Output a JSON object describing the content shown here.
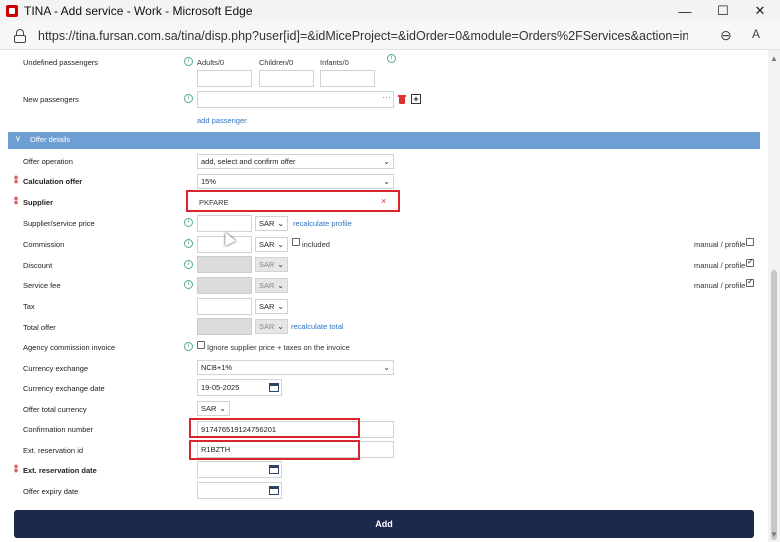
{
  "window": {
    "title": "TINA - Add service - Work - Microsoft Edge",
    "minimize": "—",
    "maximize": "☐",
    "close": "✕"
  },
  "address_bar": {
    "url": "https://tina.fursan.com.sa/tina/disp.php?user[id]=&idMiceProject=&idOrder=0&module=Orders%2FServices&action=insert"
  },
  "undefined_passengers": {
    "label": "Undefined passengers",
    "adults": "Adults/0",
    "children": "Children/0",
    "infants": "Infants/0"
  },
  "new_passengers": {
    "label": "New passengers",
    "add_link": "add passenger"
  },
  "section": {
    "title": "Offer details"
  },
  "fields": {
    "offer_operation": {
      "label": "Offer operation",
      "value": "add, select and confirm offer"
    },
    "calculation_offer": {
      "label": "Calculation offer",
      "value": "15%"
    },
    "supplier": {
      "label": "Supplier",
      "value": "PKFARE",
      "clear": "×"
    },
    "supplier_price": {
      "label": "Supplier/service price",
      "currency": "SAR",
      "link": "recalculate profile"
    },
    "commission": {
      "label": "Commission",
      "currency": "SAR",
      "included": "included",
      "right_label": "manual / profile"
    },
    "discount": {
      "label": "Discount",
      "currency": "SAR",
      "right_label": "manual / profile"
    },
    "service_fee": {
      "label": "Service fee",
      "currency": "SAR",
      "right_label": "manual / profile"
    },
    "tax": {
      "label": "Tax",
      "currency": "SAR"
    },
    "total_offer": {
      "label": "Total offer",
      "currency": "SAR",
      "link": "recalculate total"
    },
    "agency_commission": {
      "label": "Agency commission invoice",
      "checkbox_label": "Ignore supplier price + taxes on the invoice"
    },
    "currency_exchange": {
      "label": "Currency exchange",
      "value": "NCB+1%"
    },
    "currency_exchange_date": {
      "label": "Currency exchange date",
      "value": "19-05-2025"
    },
    "offer_total_currency": {
      "label": "Offer total currency",
      "value": "SAR"
    },
    "confirmation_number": {
      "label": "Confirmation number",
      "value": "917476519124756201"
    },
    "ext_reservation_id": {
      "label": "Ext. reservation id",
      "value": "R1BZTH"
    },
    "ext_reservation_date": {
      "label": "Ext. reservation date",
      "value": ""
    },
    "offer_expiry_date": {
      "label": "Offer expiry date",
      "value": ""
    }
  },
  "actions": {
    "add": "Add"
  },
  "colors": {
    "section_header": "#6d9fd4",
    "highlight": "#d9252c",
    "primary_button": "#1b2a4c",
    "link": "#2f74c0"
  }
}
